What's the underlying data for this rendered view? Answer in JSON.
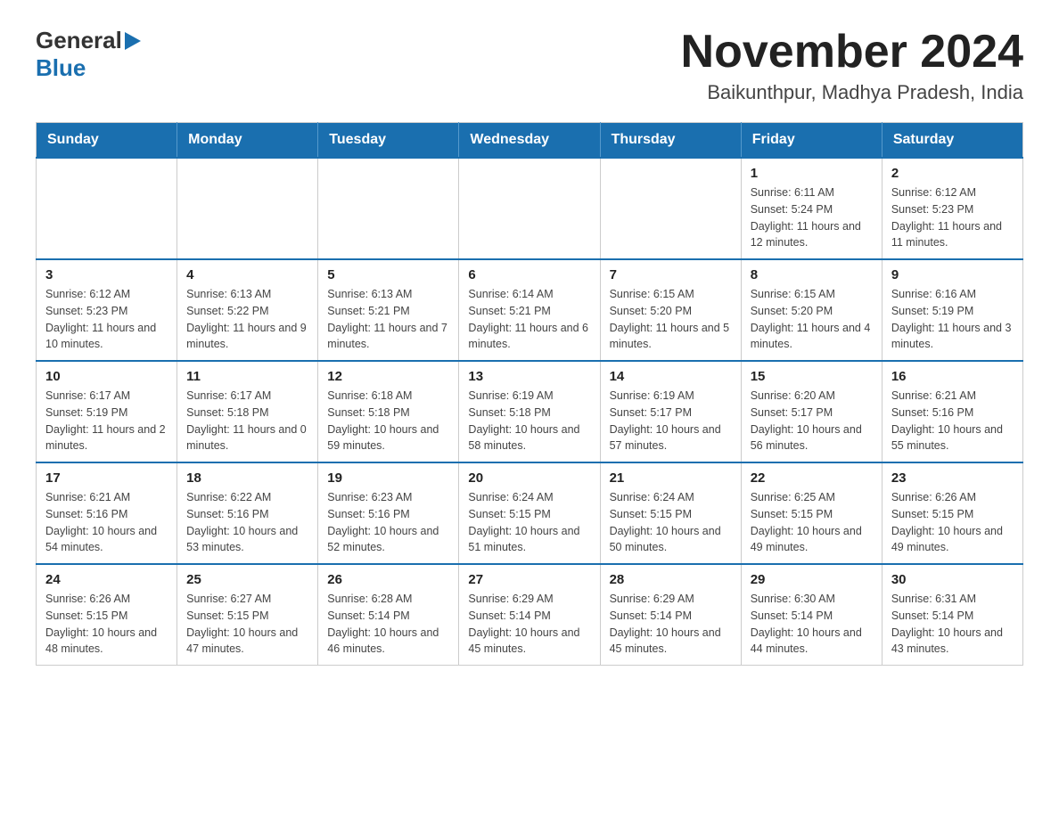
{
  "header": {
    "logo_general": "General",
    "logo_blue": "Blue",
    "month_title": "November 2024",
    "location": "Baikunthpur, Madhya Pradesh, India"
  },
  "days_of_week": [
    "Sunday",
    "Monday",
    "Tuesday",
    "Wednesday",
    "Thursday",
    "Friday",
    "Saturday"
  ],
  "weeks": [
    [
      {
        "day": "",
        "info": ""
      },
      {
        "day": "",
        "info": ""
      },
      {
        "day": "",
        "info": ""
      },
      {
        "day": "",
        "info": ""
      },
      {
        "day": "",
        "info": ""
      },
      {
        "day": "1",
        "info": "Sunrise: 6:11 AM\nSunset: 5:24 PM\nDaylight: 11 hours and 12 minutes."
      },
      {
        "day": "2",
        "info": "Sunrise: 6:12 AM\nSunset: 5:23 PM\nDaylight: 11 hours and 11 minutes."
      }
    ],
    [
      {
        "day": "3",
        "info": "Sunrise: 6:12 AM\nSunset: 5:23 PM\nDaylight: 11 hours and 10 minutes."
      },
      {
        "day": "4",
        "info": "Sunrise: 6:13 AM\nSunset: 5:22 PM\nDaylight: 11 hours and 9 minutes."
      },
      {
        "day": "5",
        "info": "Sunrise: 6:13 AM\nSunset: 5:21 PM\nDaylight: 11 hours and 7 minutes."
      },
      {
        "day": "6",
        "info": "Sunrise: 6:14 AM\nSunset: 5:21 PM\nDaylight: 11 hours and 6 minutes."
      },
      {
        "day": "7",
        "info": "Sunrise: 6:15 AM\nSunset: 5:20 PM\nDaylight: 11 hours and 5 minutes."
      },
      {
        "day": "8",
        "info": "Sunrise: 6:15 AM\nSunset: 5:20 PM\nDaylight: 11 hours and 4 minutes."
      },
      {
        "day": "9",
        "info": "Sunrise: 6:16 AM\nSunset: 5:19 PM\nDaylight: 11 hours and 3 minutes."
      }
    ],
    [
      {
        "day": "10",
        "info": "Sunrise: 6:17 AM\nSunset: 5:19 PM\nDaylight: 11 hours and 2 minutes."
      },
      {
        "day": "11",
        "info": "Sunrise: 6:17 AM\nSunset: 5:18 PM\nDaylight: 11 hours and 0 minutes."
      },
      {
        "day": "12",
        "info": "Sunrise: 6:18 AM\nSunset: 5:18 PM\nDaylight: 10 hours and 59 minutes."
      },
      {
        "day": "13",
        "info": "Sunrise: 6:19 AM\nSunset: 5:18 PM\nDaylight: 10 hours and 58 minutes."
      },
      {
        "day": "14",
        "info": "Sunrise: 6:19 AM\nSunset: 5:17 PM\nDaylight: 10 hours and 57 minutes."
      },
      {
        "day": "15",
        "info": "Sunrise: 6:20 AM\nSunset: 5:17 PM\nDaylight: 10 hours and 56 minutes."
      },
      {
        "day": "16",
        "info": "Sunrise: 6:21 AM\nSunset: 5:16 PM\nDaylight: 10 hours and 55 minutes."
      }
    ],
    [
      {
        "day": "17",
        "info": "Sunrise: 6:21 AM\nSunset: 5:16 PM\nDaylight: 10 hours and 54 minutes."
      },
      {
        "day": "18",
        "info": "Sunrise: 6:22 AM\nSunset: 5:16 PM\nDaylight: 10 hours and 53 minutes."
      },
      {
        "day": "19",
        "info": "Sunrise: 6:23 AM\nSunset: 5:16 PM\nDaylight: 10 hours and 52 minutes."
      },
      {
        "day": "20",
        "info": "Sunrise: 6:24 AM\nSunset: 5:15 PM\nDaylight: 10 hours and 51 minutes."
      },
      {
        "day": "21",
        "info": "Sunrise: 6:24 AM\nSunset: 5:15 PM\nDaylight: 10 hours and 50 minutes."
      },
      {
        "day": "22",
        "info": "Sunrise: 6:25 AM\nSunset: 5:15 PM\nDaylight: 10 hours and 49 minutes."
      },
      {
        "day": "23",
        "info": "Sunrise: 6:26 AM\nSunset: 5:15 PM\nDaylight: 10 hours and 49 minutes."
      }
    ],
    [
      {
        "day": "24",
        "info": "Sunrise: 6:26 AM\nSunset: 5:15 PM\nDaylight: 10 hours and 48 minutes."
      },
      {
        "day": "25",
        "info": "Sunrise: 6:27 AM\nSunset: 5:15 PM\nDaylight: 10 hours and 47 minutes."
      },
      {
        "day": "26",
        "info": "Sunrise: 6:28 AM\nSunset: 5:14 PM\nDaylight: 10 hours and 46 minutes."
      },
      {
        "day": "27",
        "info": "Sunrise: 6:29 AM\nSunset: 5:14 PM\nDaylight: 10 hours and 45 minutes."
      },
      {
        "day": "28",
        "info": "Sunrise: 6:29 AM\nSunset: 5:14 PM\nDaylight: 10 hours and 45 minutes."
      },
      {
        "day": "29",
        "info": "Sunrise: 6:30 AM\nSunset: 5:14 PM\nDaylight: 10 hours and 44 minutes."
      },
      {
        "day": "30",
        "info": "Sunrise: 6:31 AM\nSunset: 5:14 PM\nDaylight: 10 hours and 43 minutes."
      }
    ]
  ]
}
